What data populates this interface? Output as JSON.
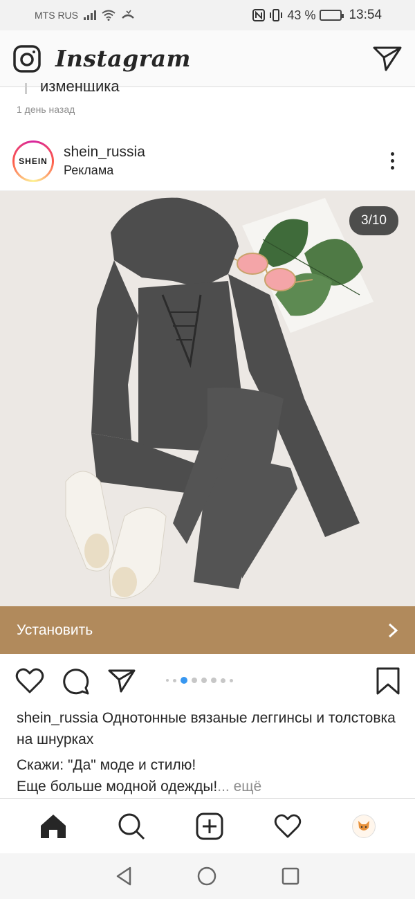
{
  "status": {
    "carrier": "MTS RUS",
    "battery_percent": "43 %",
    "battery_level": 0.43,
    "time": "13:54"
  },
  "app": {
    "title": "Instagram",
    "icons": [
      "camera-icon",
      "direct-message-icon"
    ]
  },
  "previous_post": {
    "caption_fragment": "изменщика",
    "time_ago": "1 день назад"
  },
  "post": {
    "username": "shein_russia",
    "subtitle": "Реклама",
    "avatar_text": "SHEIN",
    "image_counter": "3/10",
    "carousel_active_index": 2,
    "cta_label": "Установить",
    "caption_username": "shein_russia",
    "caption_text": "Однотонные вязаные леггинсы и толстовка на шнурках",
    "caption_line2": "Скажи: \"Да\" моде и стилю!",
    "caption_line3": "Еще больше модной одежды!",
    "more_label": "... ещё"
  },
  "colors": {
    "cta_background": "#b18a5c",
    "carousel_active": "#3897f0",
    "image_background": "#ece8e4"
  },
  "bottom_nav": [
    "home-icon",
    "search-icon",
    "new-post-icon",
    "activity-heart-icon",
    "profile-avatar"
  ],
  "system_nav": [
    "back-icon",
    "home-circle-icon",
    "recents-icon"
  ]
}
